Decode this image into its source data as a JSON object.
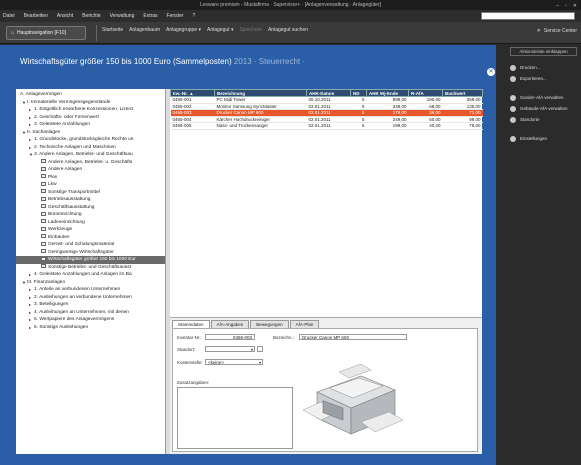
{
  "titlebar": {
    "title": "Lexware premium  -  Mustafirma · Supervisor+ · [Anlagenverwaltung · Anlagegüter]"
  },
  "menu": [
    "Datei",
    "Bearbeiten",
    "Ansicht",
    "Berichte",
    "Verwaltung",
    "Extras",
    "Fenster",
    "?"
  ],
  "toolbar": {
    "nav_label": "Hauptnavigation [F10]",
    "items": [
      "Startseite",
      "Anlagenbaum",
      "Anlagegruppe ▾",
      "Anlagegut ▾",
      "Speichern",
      "Anlagegut suchen"
    ],
    "service_center": "Service Center"
  },
  "page": {
    "title": "Wirtschaftsgüter größer 150 bis 1000 Euro (Sammelposten)",
    "title_suffix": "2013 · Steuerrecht ·"
  },
  "right_panel": {
    "header": "Aktionsleiste einklappen",
    "items": [
      "Drucken...",
      "Exportieren...",
      "Sonder-AfA verwalten",
      "Gebäude-AfA verwalten",
      "Standorte",
      "Einstellungen"
    ]
  },
  "tree": [
    {
      "label": "A. Anlagevermögen",
      "level": 0,
      "twisty": "",
      "icon": false
    },
    {
      "label": "I. Immaterielle Vermögensgegenstände",
      "level": 1,
      "twisty": "▼",
      "icon": false
    },
    {
      "label": "1. Entgeltlich erworbene Konzessionen, Lizenz",
      "level": 2,
      "twisty": "▸",
      "icon": false
    },
    {
      "label": "2. Geschäfts- oder Firmenwert",
      "level": 2,
      "twisty": "▸",
      "icon": false
    },
    {
      "label": "3. Geleistete Anzahlungen",
      "level": 2,
      "twisty": "▸",
      "icon": false
    },
    {
      "label": "II. Sachanlagen",
      "level": 1,
      "twisty": "▼",
      "icon": false
    },
    {
      "label": "1. Grundstücke, grundstücksgleiche Rechte un",
      "level": 2,
      "twisty": "▸",
      "icon": false
    },
    {
      "label": "2. Technische Anlagen und Maschinen",
      "level": 2,
      "twisty": "▸",
      "icon": false
    },
    {
      "label": "3. Andere Anlagen, Betriebs- und Geschäftsau",
      "level": 2,
      "twisty": "▼",
      "icon": false
    },
    {
      "label": "Andere Anlagen, Betriebs- u. Geschäfts",
      "level": 3,
      "twisty": "",
      "icon": true
    },
    {
      "label": "Andere Anlagen",
      "level": 3,
      "twisty": "",
      "icon": true
    },
    {
      "label": "Pkw",
      "level": 3,
      "twisty": "",
      "icon": true
    },
    {
      "label": "Lkw",
      "level": 3,
      "twisty": "",
      "icon": true
    },
    {
      "label": "Sonstige Transportmittel",
      "level": 3,
      "twisty": "",
      "icon": true
    },
    {
      "label": "Betriebsausstattung",
      "level": 3,
      "twisty": "",
      "icon": true
    },
    {
      "label": "Geschäftsausstattung",
      "level": 3,
      "twisty": "",
      "icon": true
    },
    {
      "label": "Büroeinrichtung",
      "level": 3,
      "twisty": "",
      "icon": true
    },
    {
      "label": "Ladeneinrichtung",
      "level": 3,
      "twisty": "",
      "icon": true
    },
    {
      "label": "Werkzeuge",
      "level": 3,
      "twisty": "",
      "icon": true
    },
    {
      "label": "Einbauten",
      "level": 3,
      "twisty": "",
      "icon": true
    },
    {
      "label": "Gerüst- und Schalungsmaterial",
      "level": 3,
      "twisty": "",
      "icon": true
    },
    {
      "label": "Geringwertige Wirtschaftsgüter",
      "level": 3,
      "twisty": "",
      "icon": true
    },
    {
      "label": "Wirtschaftsgüter größer 150 bis 1000 Eur",
      "level": 3,
      "twisty": "",
      "icon": true,
      "selected": true
    },
    {
      "label": "Sonstige Betriebs- und Geschäftsausst",
      "level": 3,
      "twisty": "",
      "icon": true
    },
    {
      "label": "4. Geleistete Anzahlungen und Anlagen im Ba",
      "level": 2,
      "twisty": "▸",
      "icon": false
    },
    {
      "label": "III. Finanzanlagen",
      "level": 1,
      "twisty": "▼",
      "icon": false
    },
    {
      "label": "1. Anteile an verbundenen Unternehmen",
      "level": 2,
      "twisty": "▸",
      "icon": false
    },
    {
      "label": "2. Ausleihungen an verbundene Unternehmen",
      "level": 2,
      "twisty": "▸",
      "icon": false
    },
    {
      "label": "3. Beteiligungen",
      "level": 2,
      "twisty": "▸",
      "icon": false
    },
    {
      "label": "4. Ausleihungen an Unternehmen, mit denen",
      "level": 2,
      "twisty": "▸",
      "icon": false
    },
    {
      "label": "5. Wertpapiere des Anlagevermögens",
      "level": 2,
      "twisty": "▸",
      "icon": false
    },
    {
      "label": "6. Sonstige Ausleihungen",
      "level": 2,
      "twisty": "▸",
      "icon": false
    }
  ],
  "grid": {
    "headers": [
      "Inv.-Nr. ▲",
      "Bezeichnung",
      "AHK-Datum",
      "ND",
      "AHK Wj-Ende",
      "R-AfA",
      "Buchwert"
    ],
    "rows": [
      [
        "0465-001",
        "PC Midi Tower",
        "05.10.2011",
        "5",
        "899,00",
        "180,00",
        "359,00"
      ],
      [
        "0465-002",
        "Monitor Samsung SyncMaster",
        "02.01.2011",
        "5",
        "339,00",
        "68,00",
        "135,00"
      ],
      [
        "0465-003",
        "Drucker Canon MP 600",
        "02.01.2011",
        "5",
        "179,00",
        "36,00",
        "71,00"
      ],
      [
        "0465-004",
        "Kärcher Hochdruckreiniger",
        "02.01.2011",
        "5",
        "249,00",
        "50,00",
        "99,00"
      ],
      [
        "0465-005",
        "Nass- und Trockensauger",
        "02.01.2011",
        "5",
        "199,00",
        "40,00",
        "79,00"
      ]
    ],
    "selected_row": 2
  },
  "detail": {
    "tabs": [
      "Stammdaten",
      "AfA-Angaben",
      "Bewegungen",
      "AfA-Plan"
    ],
    "inv_label": "Inventar-Nr.:",
    "inv_value": "0465-003",
    "bez_label": "Bezeichn.:",
    "bez_value": "Drucker Canon MP 600",
    "standort_label": "Standort:",
    "standort_value": "",
    "kst_label": "Kostenstelle:",
    "kst_value": "<keine>",
    "zusatz_label": "Zusatzangaben:"
  },
  "colors": {
    "accent_blue": "#2a5ea6",
    "selection": "#e8572a",
    "grid_header": "#2e4b72"
  }
}
